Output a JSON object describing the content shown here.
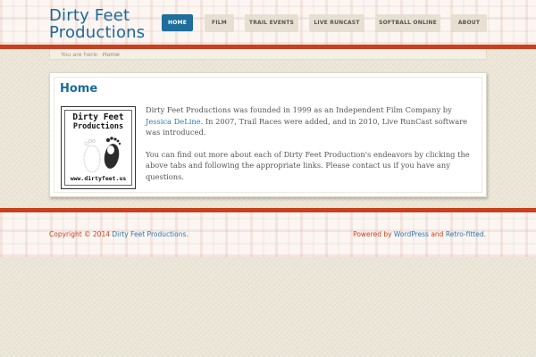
{
  "site": {
    "title_line1": "Dirty Feet",
    "title_line2": "Productions"
  },
  "nav": {
    "items": [
      {
        "label": "Home",
        "active": true
      },
      {
        "label": "Film"
      },
      {
        "label": "Trail Events"
      },
      {
        "label": "Live RunCast"
      },
      {
        "label": "Softball Online"
      },
      {
        "label": "About"
      }
    ]
  },
  "breadcrumb": {
    "prefix": "You are here:",
    "current": "Home"
  },
  "page": {
    "title": "Home",
    "logo": {
      "line1": "Dirty Feet",
      "line2": "Productions",
      "url": "www.dirtyfeet.us"
    },
    "paragraph1": {
      "before_link": "Dirty Feet Productions was founded in 1999 as an Independent Film Company by ",
      "link": "Jessica DeLine",
      "after_link": ". In 2007, Trail Races were added, and in 2010, Live RunCast software was introduced."
    },
    "paragraph2": "You can find out more about each of Dirty Feet Production's endeavors by clicking the above tabs and following the appropriate links. Please contact us if you have any questions."
  },
  "footer": {
    "copyright_prefix": "Copyright © 2014 ",
    "copyright_link": "Dirty Feet Productions",
    "copyright_suffix": ".",
    "powered_prefix": "Powered by ",
    "powered_link1": "WordPress",
    "powered_and": " and ",
    "powered_link2": "Retro-fitted",
    "powered_suffix": "."
  },
  "colors": {
    "accent_blue": "#1b6a9a",
    "accent_red": "#c8401e",
    "nav_active": "#1f6e9c"
  }
}
